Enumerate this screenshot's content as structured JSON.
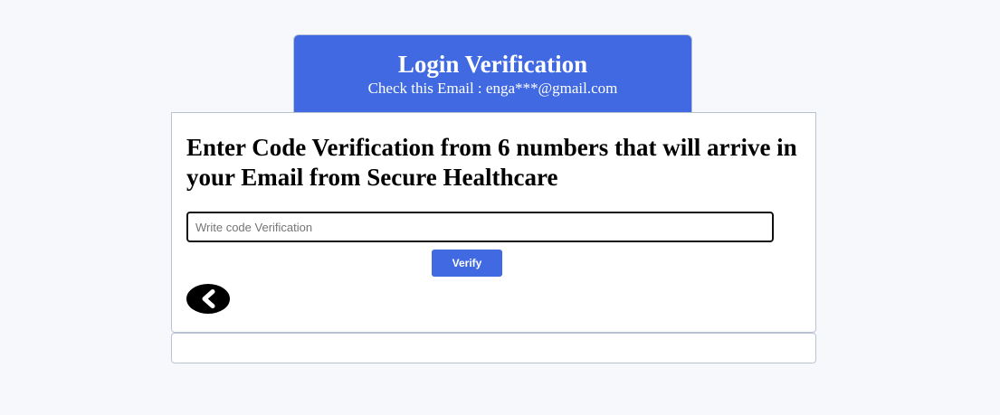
{
  "header": {
    "title": "Login Verification",
    "subtitle": "Check this Email : enga***@gmail.com"
  },
  "main": {
    "instructions": "Enter Code Verification from 6 numbers that will arrive in your Email from Secure Healthcare",
    "code_input": {
      "value": "",
      "placeholder": "Write code Verification"
    },
    "verify_label": "Verify",
    "back_icon": "chevron-left-icon"
  },
  "colors": {
    "accent": "#4169e1",
    "background": "#f7f8fc",
    "border": "#b9c3d6",
    "text": "#000000"
  }
}
